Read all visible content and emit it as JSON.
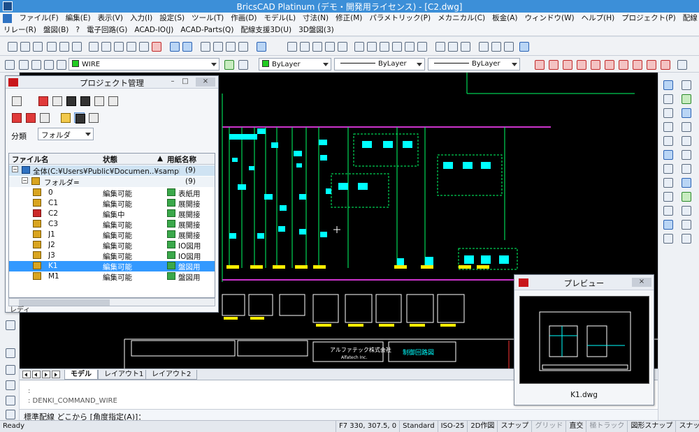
{
  "window": {
    "title": "BricsCAD Platinum (デモ・開発用ライセンス) - [C2.dwg]"
  },
  "menu": {
    "row1": [
      "ファイル(F)",
      "編集(E)",
      "表示(V)",
      "入力(I)",
      "設定(S)",
      "ツール(T)",
      "作画(D)",
      "モデル(L)",
      "寸法(N)",
      "修正(M)",
      "パラメトリック(P)",
      "メカニカル(C)",
      "板金(A)",
      "ウィンドウ(W)",
      "ヘルプ(H)",
      "プロジェクト(P)",
      "配線"
    ],
    "row2": [
      "リレー(R)",
      "盤図(B)",
      "?",
      "電子回路(G)",
      "ACAD-IO(J)",
      "ACAD-Parts(Q)",
      "配線支援3D(U)",
      "3D盤図(3)"
    ]
  },
  "toolbar2": {
    "layer": "WIRE",
    "color": "ByLayer",
    "linetype": "ByLayer",
    "lineweight": "ByLayer"
  },
  "colors": {
    "title": "#3c8fd8",
    "selection": "#3399ff",
    "canvas": "#000000",
    "wire": "#00ff66",
    "cyan": "#00ffff",
    "magenta": "#cc33cc",
    "yellow": "#ffee00"
  },
  "project_manager": {
    "title": "プロジェクト管理",
    "minimize": "–",
    "restore": "□",
    "close": "×",
    "classification_label": "分類",
    "classification_value": "フォルダ",
    "columns": {
      "name": "ファイル名",
      "state": "状態",
      "paper": "用紙名称"
    },
    "root": {
      "name": "全体(C:¥Users¥Public¥Documen..¥sample)",
      "count": "(9)"
    },
    "folder": {
      "name": "フォルダ=",
      "count": "(9)"
    },
    "files": [
      {
        "name": "0",
        "state": "編集可能",
        "paper": "表紙用"
      },
      {
        "name": "C1",
        "state": "編集可能",
        "paper": "展開接"
      },
      {
        "name": "C2",
        "state": "編集中",
        "paper": "展開接"
      },
      {
        "name": "C3",
        "state": "編集可能",
        "paper": "展開接"
      },
      {
        "name": "J1",
        "state": "編集可能",
        "paper": "展開接"
      },
      {
        "name": "J2",
        "state": "編集可能",
        "paper": "IO図用"
      },
      {
        "name": "J3",
        "state": "編集可能",
        "paper": "IO図用"
      },
      {
        "name": "K1",
        "state": "編集可能",
        "paper": "盤図用"
      },
      {
        "name": "M1",
        "state": "編集可能",
        "paper": "盤図用"
      }
    ],
    "footer": "レディ"
  },
  "preview": {
    "title": "プレビュー",
    "close": "×",
    "filename": "K1.dwg"
  },
  "drawing": {
    "company_jp": "アルファテック株式会社",
    "company_en": "Alfatech Inc.",
    "sheet_title": "制御回路図"
  },
  "layout_tabs": [
    "モデル",
    "レイアウト1",
    "レイアウト2"
  ],
  "command": {
    "history1": ":",
    "history2": ": DENKI_COMMAND_WIRE",
    "prompt": "標準配線 どこから [角度指定(A)]："
  },
  "status": {
    "ready": "Ready",
    "cells": [
      {
        "label": "F7 330, 307.5, 0",
        "on": true
      },
      {
        "label": "Standard",
        "on": true
      },
      {
        "label": "ISO-25",
        "on": true
      },
      {
        "label": "2D作図",
        "on": true
      },
      {
        "label": "スナップ",
        "on": true
      },
      {
        "label": "グリッド",
        "on": false
      },
      {
        "label": "直交",
        "on": true
      },
      {
        "label": "極トラック",
        "on": false
      },
      {
        "label": "図形スナップ",
        "on": true
      },
      {
        "label": "スナップトラ",
        "on": true
      }
    ]
  }
}
